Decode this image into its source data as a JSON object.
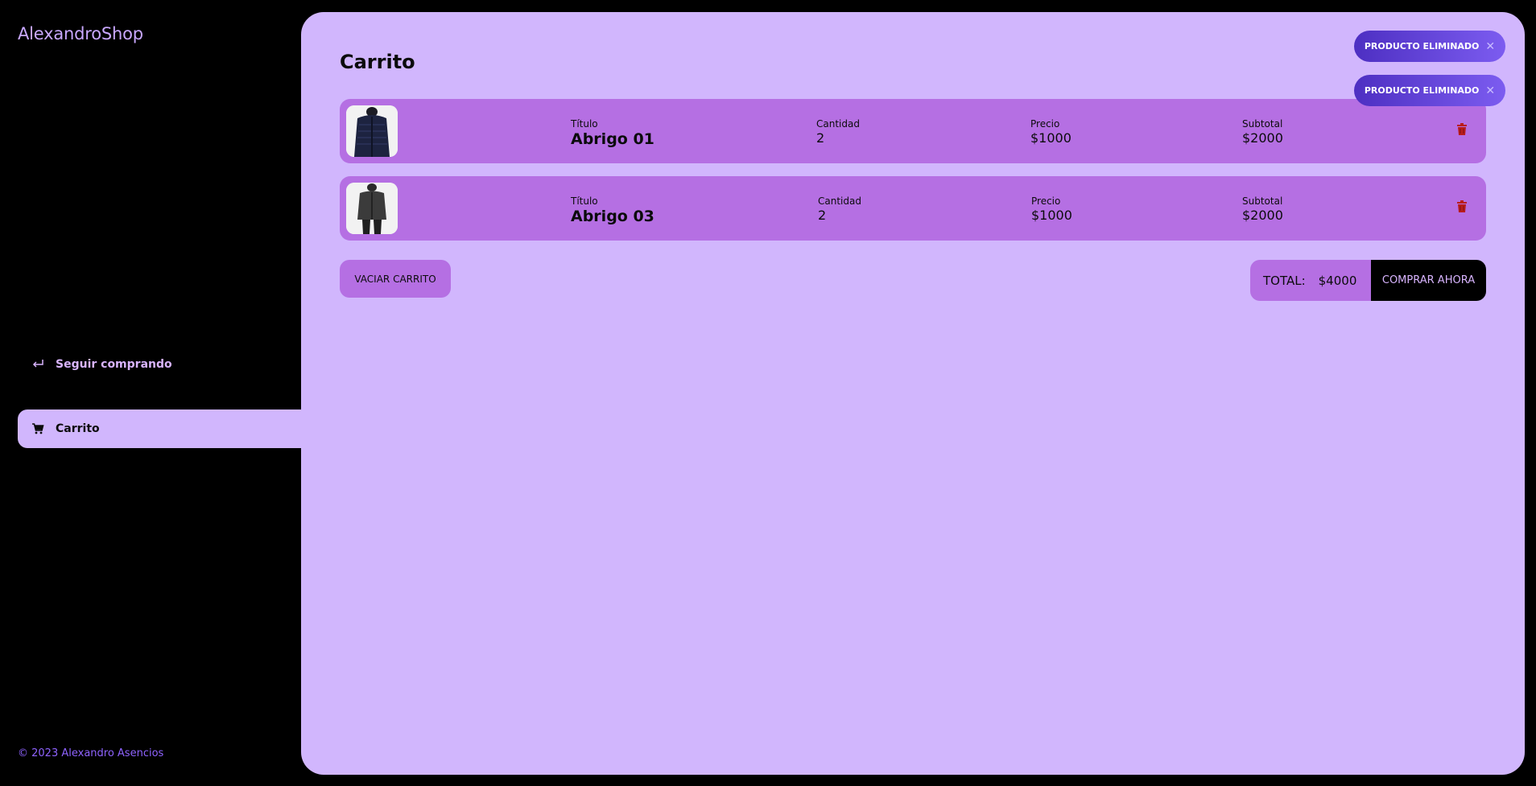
{
  "app": {
    "name": "AlexandroShop"
  },
  "sidebar": {
    "items": [
      {
        "label": "Seguir comprando",
        "icon": "return-arrow-icon",
        "active": false
      },
      {
        "label": "Carrito",
        "icon": "cart-icon",
        "active": true
      }
    ],
    "footer": "© 2023 Alexandro Asencios"
  },
  "main": {
    "title": "Carrito",
    "items": [
      {
        "title_label": "Título",
        "title": "Abrigo 01",
        "qty_label": "Cantidad",
        "qty": "2",
        "price_label": "Precio",
        "price": "$1000",
        "subtotal_label": "Subtotal",
        "subtotal": "$2000"
      },
      {
        "title_label": "Título",
        "title": "Abrigo 03",
        "qty_label": "Cantidad",
        "qty": "2",
        "price_label": "Precio",
        "price": "$1000",
        "subtotal_label": "Subtotal",
        "subtotal": "$2000"
      }
    ],
    "empty_button": "VACIAR CARRITO",
    "total_label": "TOTAL:",
    "total_value": "$4000",
    "buy_button": "COMPRAR AHORA"
  },
  "toasts": [
    {
      "text": "PRODUCTO ELIMINADO",
      "close": "✕"
    },
    {
      "text": "PRODUCTO ELIMINADO",
      "close": "✕"
    }
  ],
  "colors": {
    "background": "#000000",
    "panel": "#d1b6fd",
    "card": "#b56fe3",
    "accent": "#8f63ff",
    "trash": "#b91c1c"
  }
}
